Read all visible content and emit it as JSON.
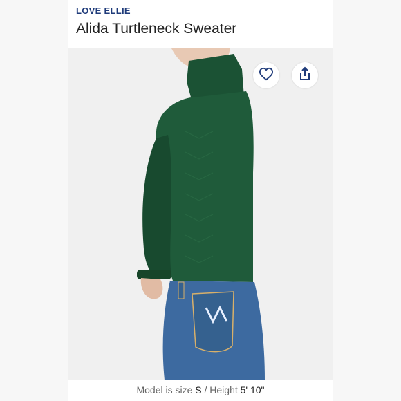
{
  "brand": "LOVE ELLIE",
  "product_title": "Alida Turtleneck Sweater",
  "icons": {
    "like": "heart-icon",
    "share": "share-icon"
  },
  "model_info": {
    "size_label": "Model is size",
    "size_value": "S",
    "separator": "/",
    "height_label": "Height",
    "height_value": "5' 10\""
  },
  "colors": {
    "brand": "#1f3b7a",
    "sweater": "#1f5b3a",
    "jeans": "#3d6aa0"
  }
}
